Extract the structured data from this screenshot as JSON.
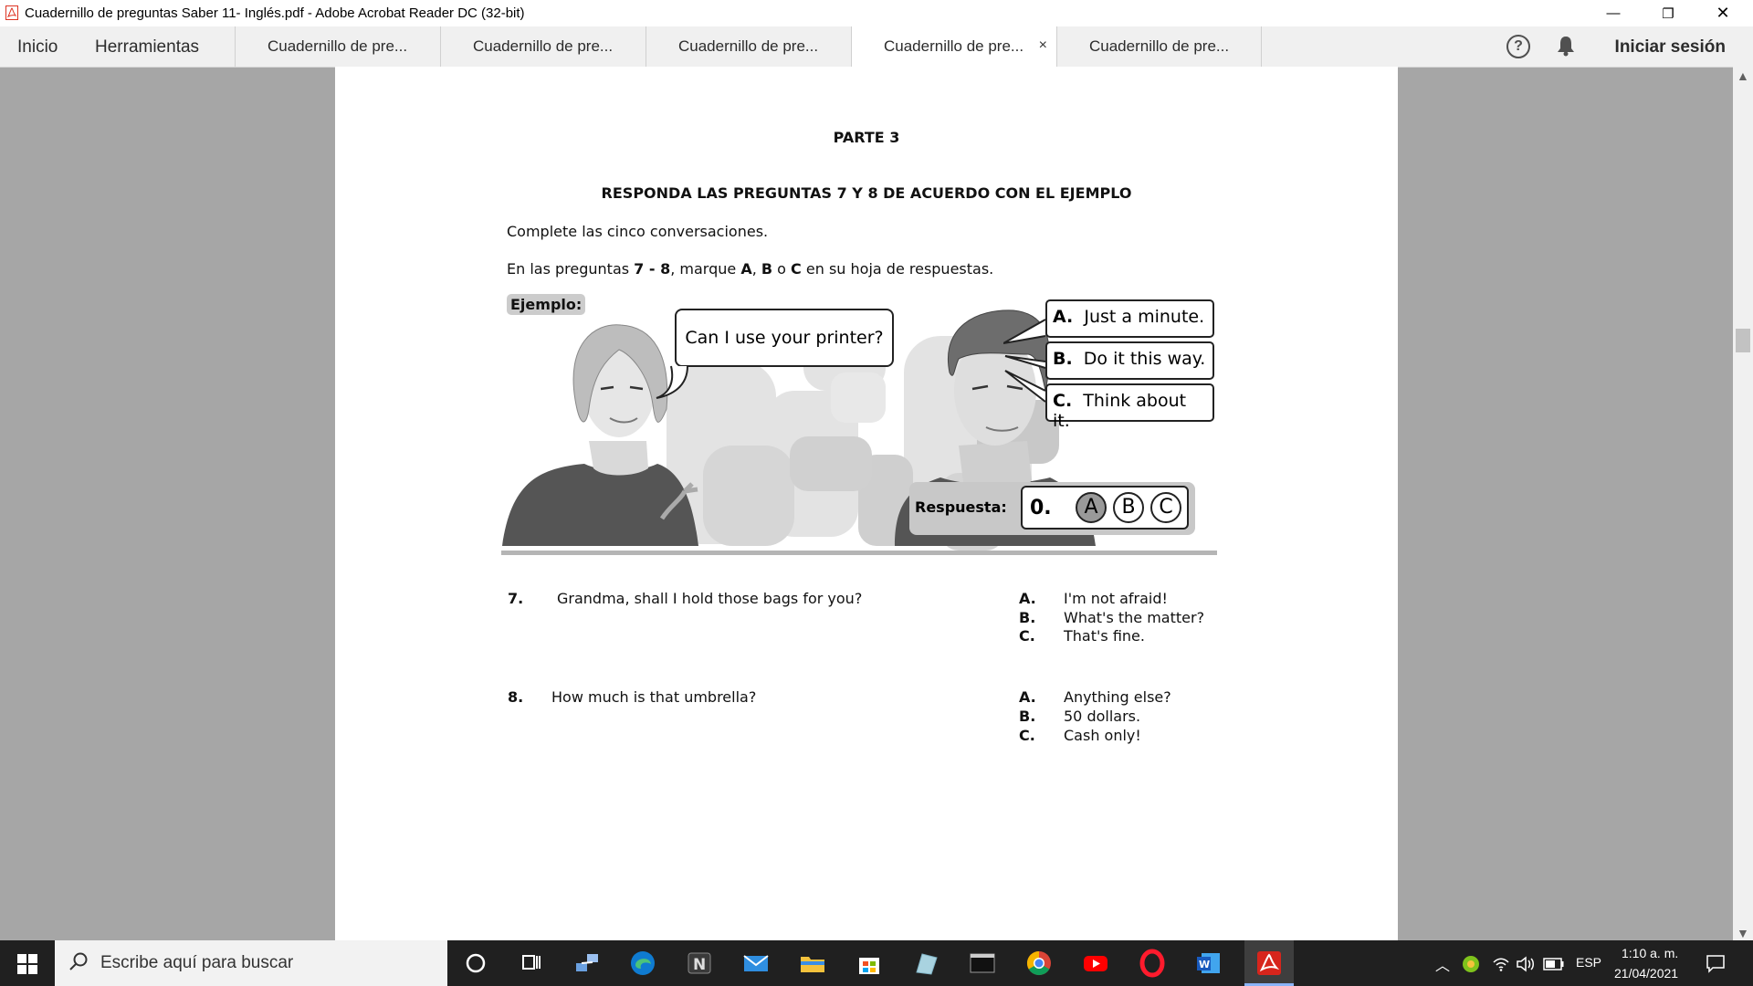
{
  "window": {
    "title": "Cuadernillo de preguntas Saber 11- Inglés.pdf - Adobe Acrobat Reader DC (32-bit)",
    "controls": {
      "minimize": "—",
      "restore": "❐",
      "close": "✕"
    }
  },
  "nav": {
    "home": "Inicio",
    "tools": "Herramientas",
    "sign_in": "Iniciar sesión"
  },
  "tabs": [
    {
      "label": "Cuadernillo de pre..."
    },
    {
      "label": "Cuadernillo de pre..."
    },
    {
      "label": "Cuadernillo de pre..."
    },
    {
      "label": "Cuadernillo de pre...",
      "active": true,
      "close": "×"
    },
    {
      "label": "Cuadernillo de pre..."
    }
  ],
  "doc": {
    "part": "PARTE 3",
    "heading": "RESPONDA LAS PREGUNTAS 7 Y 8 DE ACUERDO CON EL EJEMPLO",
    "instruction1": "Complete las cinco conversaciones.",
    "instruction2": {
      "t1": "En las preguntas ",
      "b1": "7 - 8",
      "t2": ", marque ",
      "b2": "A",
      "t3": ", ",
      "b3": "B",
      "t4": " o ",
      "b4": "C",
      "t5": " en su hoja de respuestas."
    },
    "example": {
      "label": "Ejemplo:",
      "speech": "Can I use your printer?",
      "options": [
        {
          "letter": "A.",
          "text": "Just a minute."
        },
        {
          "letter": "B.",
          "text": "Do it this way."
        },
        {
          "letter": "C.",
          "text": "Think about it."
        }
      ],
      "answer_label": "Respuesta:",
      "answer_num": "0.",
      "answer_choices": [
        "A",
        "B",
        "C"
      ],
      "selected": "A"
    },
    "questions": [
      {
        "number": "7.",
        "text": "Grandma, shall I hold those bags for you?",
        "options": [
          {
            "letter": "A.",
            "text": "I'm not afraid!"
          },
          {
            "letter": "B.",
            "text": "What's the matter?"
          },
          {
            "letter": "C.",
            "text": "That's fine."
          }
        ]
      },
      {
        "number": "8.",
        "text": "How much is that umbrella?",
        "options": [
          {
            "letter": "A.",
            "text": "Anything else?"
          },
          {
            "letter": "B.",
            "text": "50 dollars."
          },
          {
            "letter": "C.",
            "text": "Cash only!"
          }
        ]
      }
    ]
  },
  "taskbar": {
    "search_placeholder": "Escribe aquí para buscar",
    "language": "ESP",
    "time": "1:10 a. m.",
    "date": "21/04/2021"
  }
}
